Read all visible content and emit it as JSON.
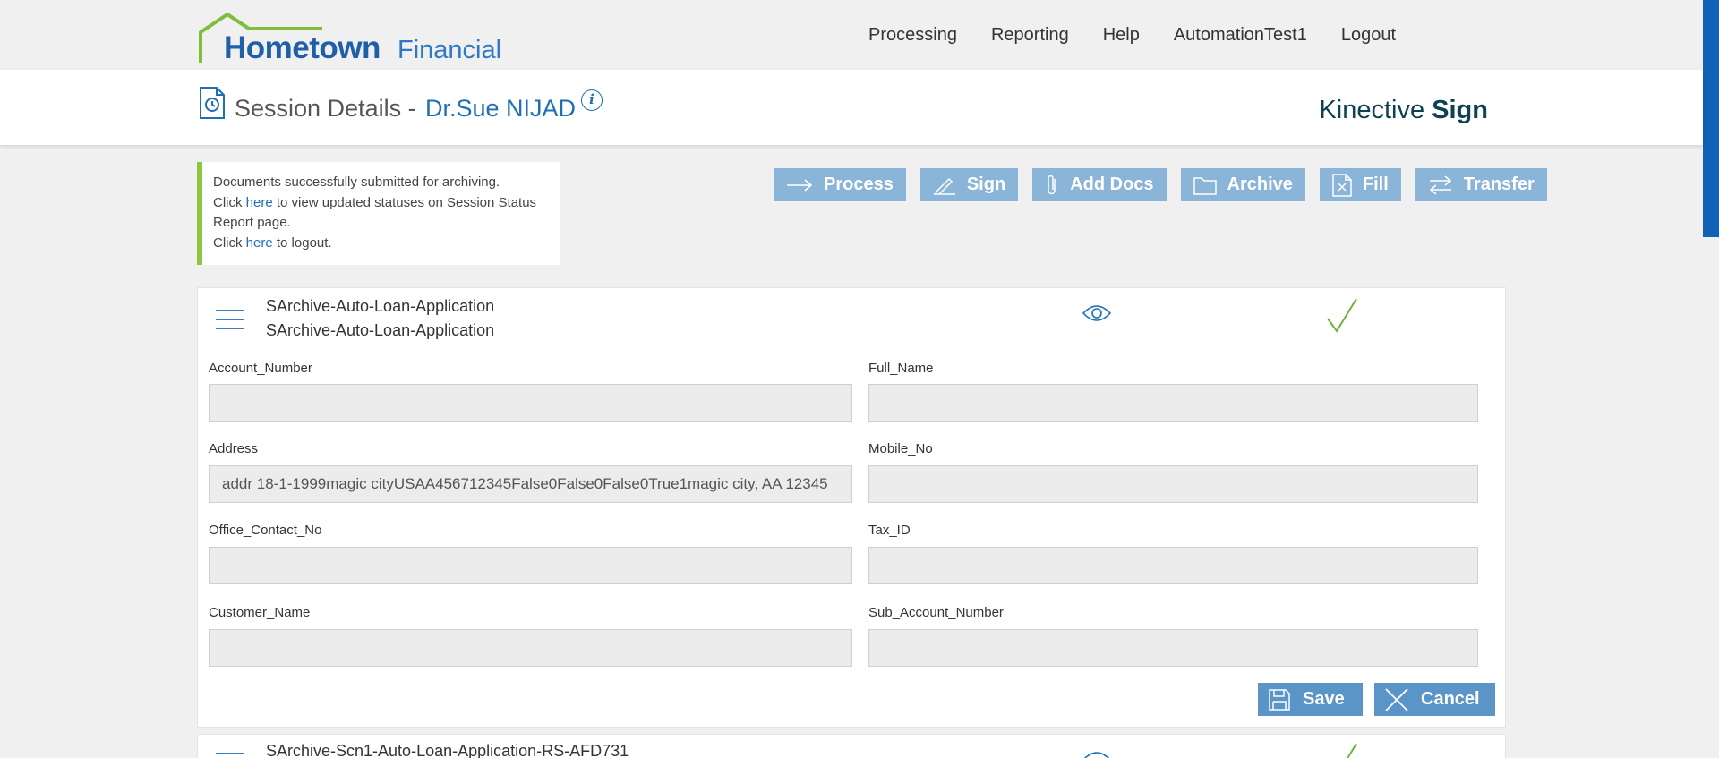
{
  "brand": {
    "name_bold": "Hometown",
    "name_light": "Financial"
  },
  "nav": [
    "Processing",
    "Reporting",
    "Help",
    "AutomationTest1",
    "Logout"
  ],
  "session": {
    "title": "Session Details -",
    "name": "Dr.Sue NIJAD"
  },
  "product": {
    "prefix": "Kinective",
    "suffix": "Sign"
  },
  "alert": {
    "line1": "Documents successfully submitted for archiving.",
    "click": "Click",
    "here": "here",
    "line2_rest": "to view updated statuses on Session Status Report page.",
    "line3_rest": "to logout."
  },
  "actions": [
    "Process",
    "Sign",
    "Add Docs",
    "Archive",
    "Fill",
    "Transfer"
  ],
  "document1": {
    "name1": "SArchive-Auto-Loan-Application",
    "name2": "SArchive-Auto-Loan-Application",
    "fields": [
      {
        "label": "Account_Number",
        "value": ""
      },
      {
        "label": "Full_Name",
        "value": ""
      },
      {
        "label": "Address",
        "value": "addr 18-1-1999magic cityUSAA456712345False0False0False0True1magic city, AA 12345"
      },
      {
        "label": "Mobile_No",
        "value": ""
      },
      {
        "label": "Office_Contact_No",
        "value": ""
      },
      {
        "label": "Tax_ID",
        "value": ""
      },
      {
        "label": "Customer_Name",
        "value": ""
      },
      {
        "label": "Sub_Account_Number",
        "value": ""
      }
    ],
    "save": "Save",
    "cancel": "Cancel"
  },
  "document2": {
    "name": "SArchive-Scn1-Auto-Loan-Application-RS-AFD731"
  },
  "colors": {
    "primary": "#1e6fb5",
    "button": "#8ab4d8",
    "button_dark": "#5b95c8",
    "success": "#8cc63f"
  }
}
